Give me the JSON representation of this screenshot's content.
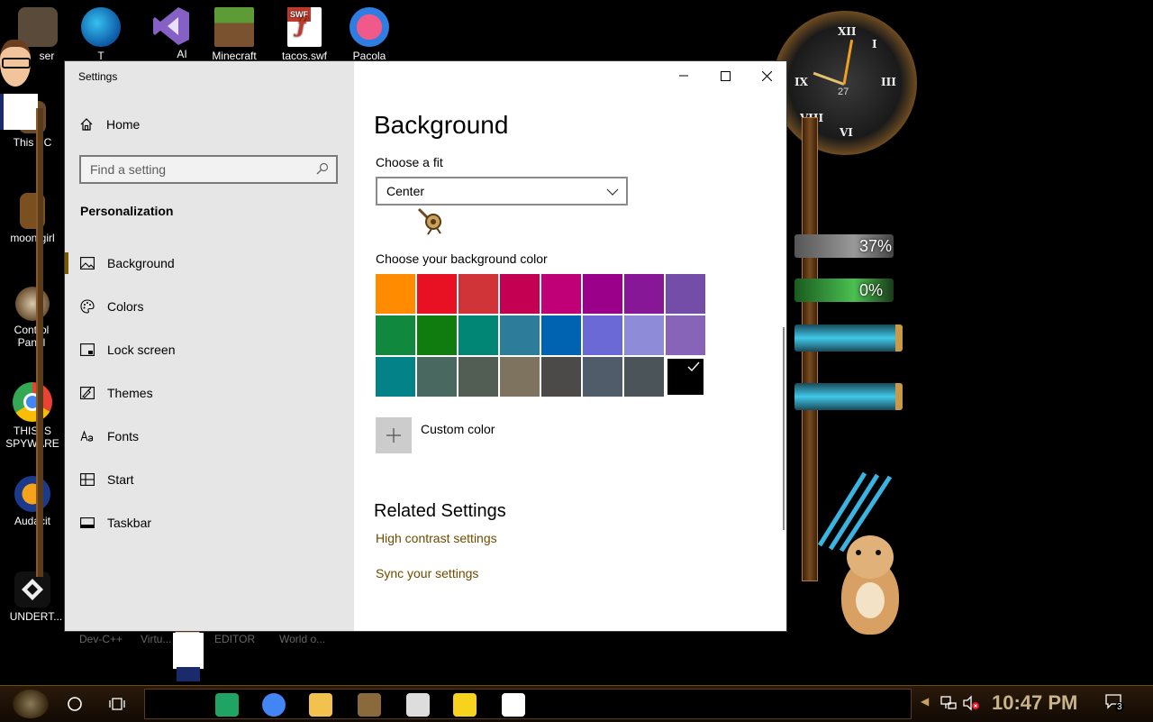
{
  "desktop": {
    "icons": [
      {
        "label": "ser"
      },
      {
        "label": "T"
      },
      {
        "label": "AI"
      },
      {
        "label": "Minecraft"
      },
      {
        "label": "tacos.swf"
      },
      {
        "label": "Pacola"
      },
      {
        "label": "This PC"
      },
      {
        "label": "moon girl"
      },
      {
        "label": "Control Panel"
      },
      {
        "label": "THIS IS SPYWARE"
      },
      {
        "label": "Audacit"
      },
      {
        "label": "UNDERT..."
      }
    ],
    "behind_window_labels": [
      "Dev-C++",
      "Virtu...",
      "EDITOR",
      "World o..."
    ],
    "gadgets": {
      "clock_date": "27",
      "meter1": "37%",
      "meter2": "0%"
    },
    "swf_badge": "SWF"
  },
  "window": {
    "title": "Settings",
    "sidebar": {
      "home_label": "Home",
      "search_placeholder": "Find a setting",
      "section_title": "Personalization",
      "items": [
        {
          "label": "Background",
          "icon": "picture-icon"
        },
        {
          "label": "Colors",
          "icon": "palette-icon"
        },
        {
          "label": "Lock screen",
          "icon": "lock-screen-icon"
        },
        {
          "label": "Themes",
          "icon": "themes-icon"
        },
        {
          "label": "Fonts",
          "icon": "fonts-icon"
        },
        {
          "label": "Start",
          "icon": "start-icon"
        },
        {
          "label": "Taskbar",
          "icon": "taskbar-icon"
        }
      ],
      "selected_index": 0
    },
    "content": {
      "page_title": "Background",
      "fit_label": "Choose a fit",
      "fit_value": "Center",
      "color_label": "Choose your background color",
      "colors": [
        "#FF8C00",
        "#E81123",
        "#D13438",
        "#C30052",
        "#BF0077",
        "#9A0089",
        "#881798",
        "#744DA9",
        "#10893E",
        "#107C10",
        "#018574",
        "#2D7D9A",
        "#0063B1",
        "#6B69D6",
        "#8E8CD8",
        "#8764B8",
        "#038387",
        "#486860",
        "#525E54",
        "#7E735F",
        "#4C4A48",
        "#515C6B",
        "#4A5459",
        "#000000"
      ],
      "selected_color_index": 23,
      "custom_color_label": "Custom color",
      "related_title": "Related Settings",
      "links": [
        "High contrast settings",
        "Sync your settings"
      ]
    },
    "accent_color": "#6E4C00"
  },
  "taskbar": {
    "time": "10:47 PM",
    "notification_count": "3",
    "pinned_apps": [
      {
        "icon": "sheets-icon",
        "color": "#1FA463"
      },
      {
        "icon": "chrome-icon",
        "color": "#4285F4"
      },
      {
        "icon": "file-explorer-icon",
        "color": "#F2C14E"
      },
      {
        "icon": "sandbox-icon",
        "color": "#8A6A3A"
      },
      {
        "icon": "7zip-icon",
        "color": "#DDDDDD"
      },
      {
        "icon": "sticky-notes-icon",
        "color": "#F7D31E"
      },
      {
        "icon": "settings-gear-icon",
        "color": "#FFFFFF"
      }
    ]
  }
}
